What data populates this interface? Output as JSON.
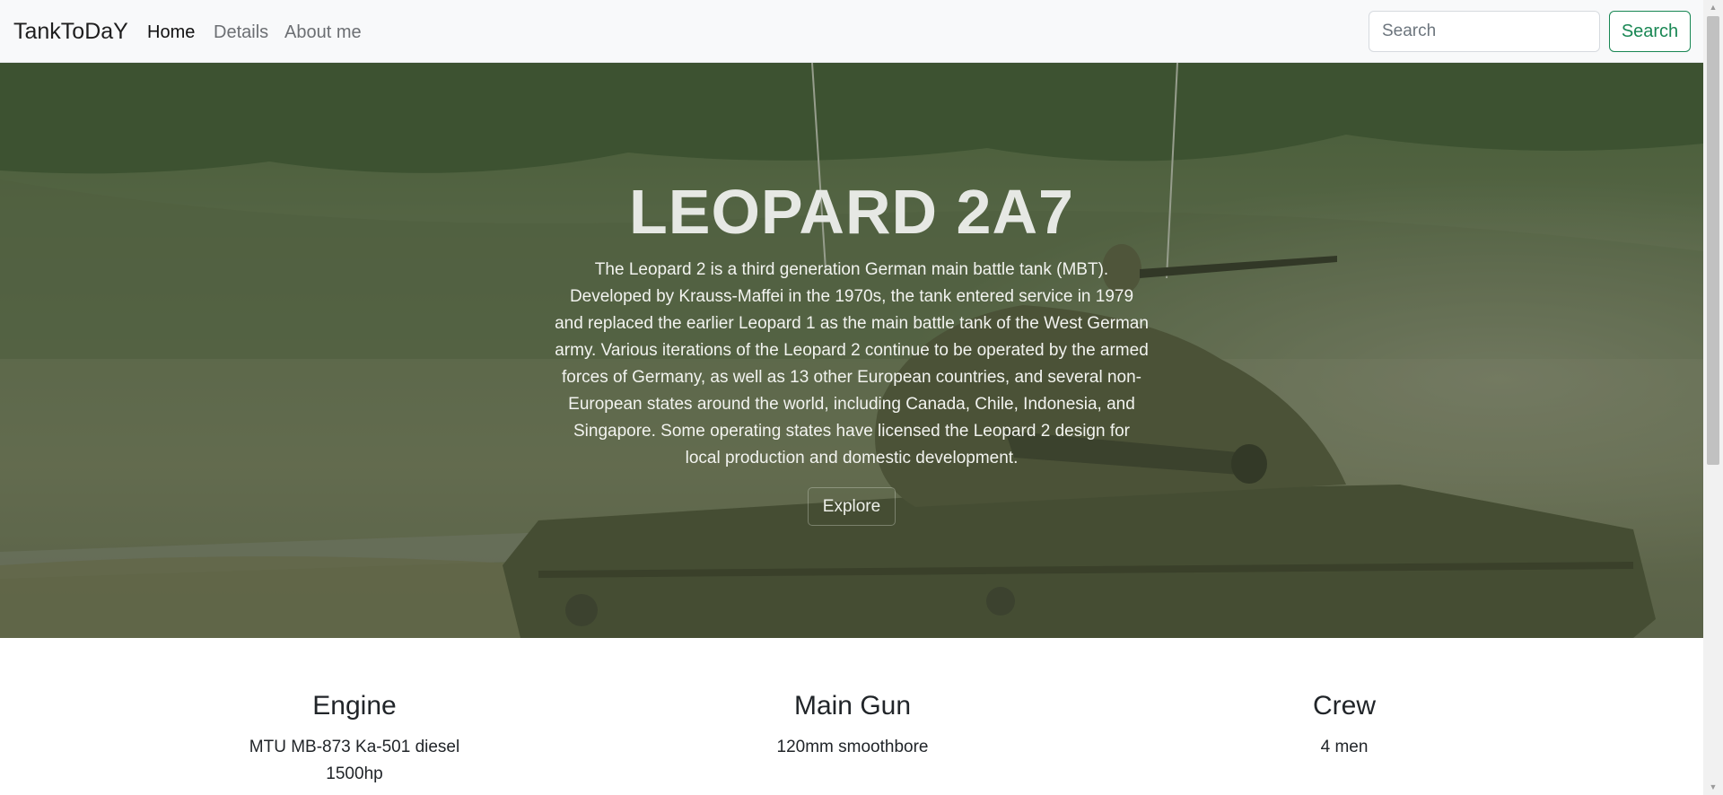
{
  "navbar": {
    "brand": "TankToDaY",
    "links": [
      {
        "label": "Home",
        "active": true
      },
      {
        "label": "Details",
        "active": false
      },
      {
        "label": "About me",
        "active": false
      }
    ],
    "search": {
      "placeholder": "Search",
      "value": "",
      "button_label": "Search"
    }
  },
  "hero": {
    "title": "LEOPARD 2A7",
    "description": "The Leopard 2 is a third generation German main battle tank (MBT). Developed by Krauss-Maffei in the 1970s, the tank entered service in 1979 and replaced the earlier Leopard 1 as the main battle tank of the West German army. Various iterations of the Leopard 2 continue to be operated by the armed forces of Germany, as well as 13 other European countries, and several non-European states around the world, including Canada, Chile, Indonesia, and Singapore. Some operating states have licensed the Leopard 2 design for local production and domestic development.",
    "button_label": "Explore"
  },
  "features": [
    {
      "title": "Engine",
      "value": "MTU MB-873 Ka-501 diesel 1500hp"
    },
    {
      "title": "Main Gun",
      "value": "120mm smoothbore"
    },
    {
      "title": "Crew",
      "value": "4 men"
    }
  ],
  "colors": {
    "navbar_bg": "#f8f9fa",
    "success": "#198754"
  },
  "icons": {
    "scroll_up": "triangle-up-icon",
    "scroll_down": "triangle-down-icon"
  }
}
